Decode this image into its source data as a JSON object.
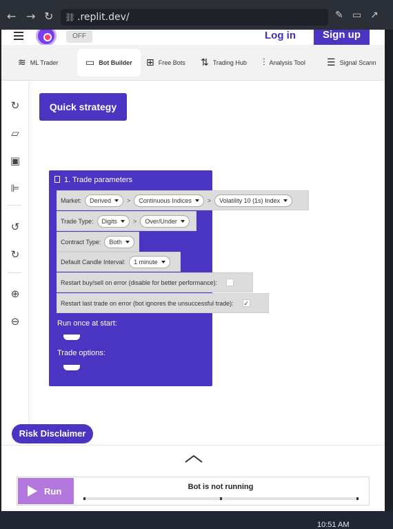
{
  "browser": {
    "url": ".replit.dev/"
  },
  "header": {
    "toggle_label": "OFF",
    "login_label": "Log in",
    "signup_label": "Sign up"
  },
  "tabs": [
    {
      "label": "ML Trader",
      "icon": "layers-icon"
    },
    {
      "label": "Bot Builder",
      "icon": "monitor-icon"
    },
    {
      "label": "Free Bots",
      "icon": "grid-plus-icon"
    },
    {
      "label": "Trading Hub",
      "icon": "arrows-icon"
    },
    {
      "label": "Analysis Tool",
      "icon": "candles-icon"
    },
    {
      "label": "Signal Scann",
      "icon": "list-icon"
    }
  ],
  "toolbar": {
    "quick_strategy_label": "Quick strategy"
  },
  "block": {
    "title": "1. Trade parameters",
    "market_label": "Market:",
    "market_values": [
      "Derived",
      "Continuous Indices",
      "Volatility 10 (1s) Index"
    ],
    "trade_type_label": "Trade Type:",
    "trade_type_values": [
      "Digits",
      "Over/Under"
    ],
    "contract_type_label": "Contract Type:",
    "contract_type_value": "Both",
    "candle_label": "Default Candle Interval:",
    "candle_value": "1 minute",
    "restart_buy_sell_label": "Restart buy/sell on error (disable for better performance):",
    "restart_last_label": "Restart last trade on error (bot ignores the unsuccessful trade):",
    "restart_last_checked": "✓",
    "run_once_label": "Run once at start:",
    "trade_options_label": "Trade options:"
  },
  "risk_disclaimer_label": "Risk Disclaimer",
  "run_panel": {
    "run_label": "Run",
    "status_text": "Bot is not running"
  },
  "taskbar": {
    "clock": "10:51 AM"
  }
}
